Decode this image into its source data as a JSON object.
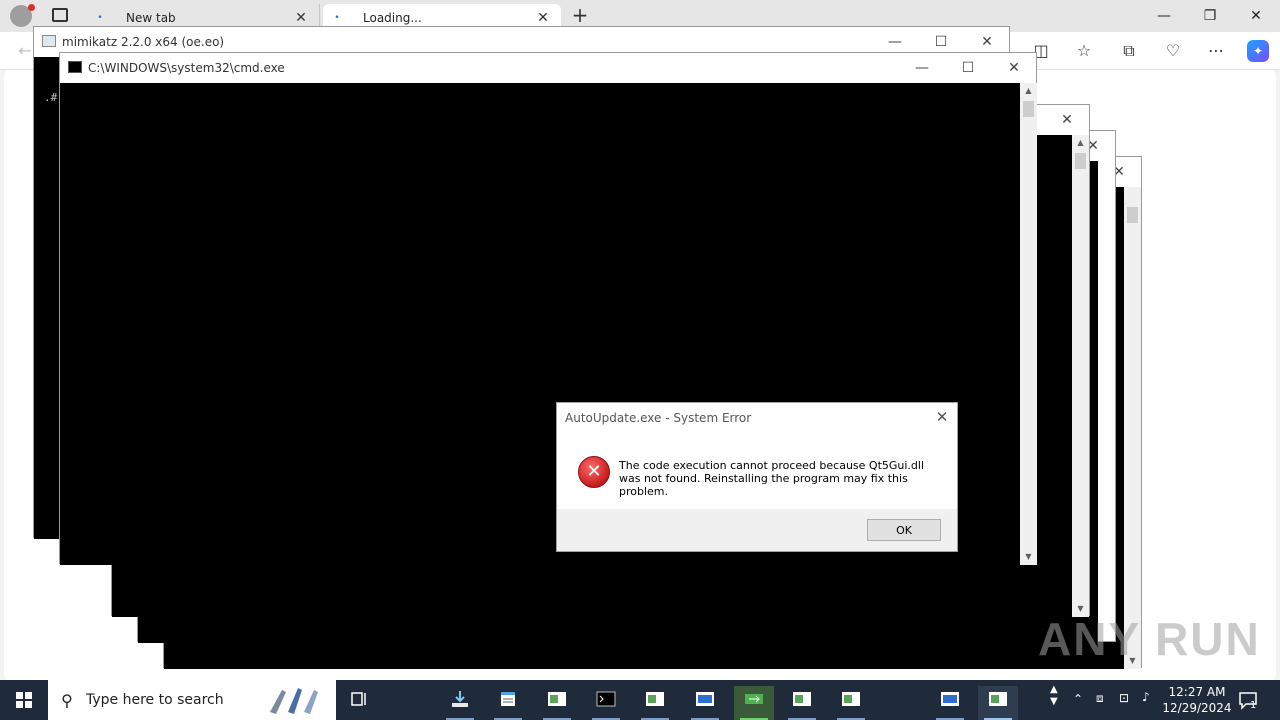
{
  "browser": {
    "tabs": [
      {
        "label": "New tab",
        "favicon": "dot-icon"
      },
      {
        "label": "Loading...",
        "favicon": "dot-icon"
      }
    ],
    "new_tab_symbol": "+",
    "window_controls": {
      "minimize": "—",
      "restore": "❐",
      "close": "✕"
    }
  },
  "windows": {
    "mimikatz": {
      "title": "mimikatz 2.2.0 x64 (oe.eo)",
      "console_text": ".#"
    },
    "cmd": {
      "title": "C:\\WINDOWS\\system32\\cmd.exe"
    }
  },
  "dialog": {
    "title": "AutoUpdate.exe - System Error",
    "message": "The code execution cannot proceed because Qt5Gui.dll was not found. Reinstalling the program may fix this problem.",
    "ok_label": "OK"
  },
  "watermark": "ANY RUN",
  "taskbar": {
    "search_placeholder": "Type here to search",
    "clock_time": "12:27 AM",
    "clock_date": "12/29/2024",
    "notification_count": "1"
  },
  "colors": {
    "taskbar": "#1f2b3a",
    "console": "#000000",
    "error_red": "#c41c1c"
  }
}
